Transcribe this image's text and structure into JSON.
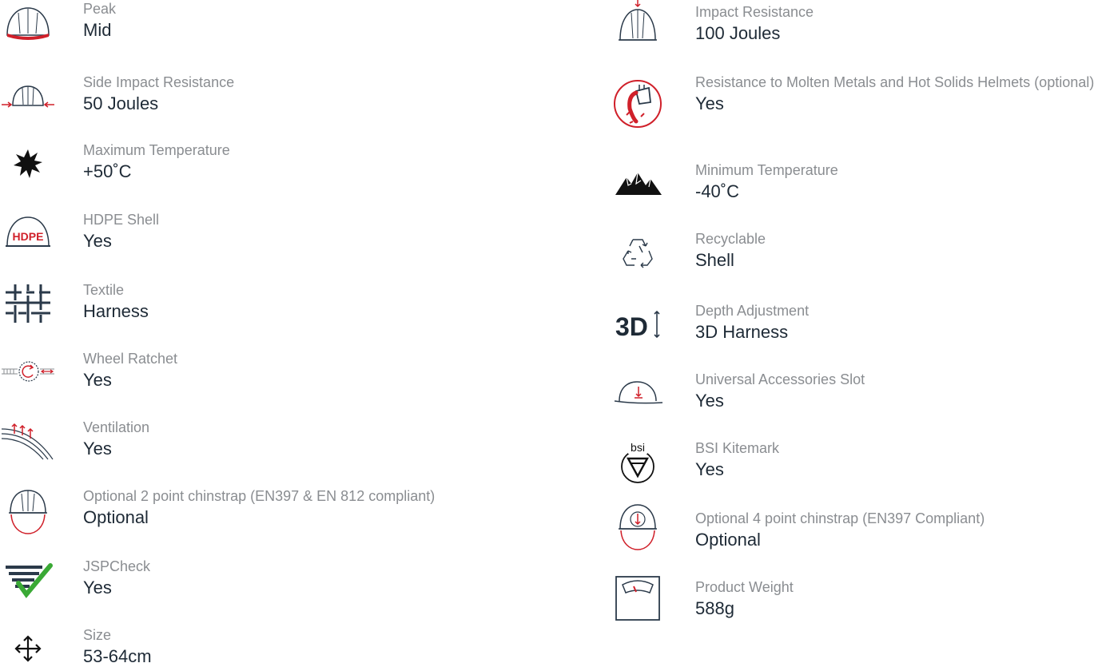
{
  "colors": {
    "label": "#8a8d91",
    "value": "#1e2a36",
    "accent_red": "#d0202a",
    "icon_dark": "#2b3a4a",
    "check_green": "#3aa935"
  },
  "left_specs": [
    {
      "icon": "helmet-peak-icon",
      "label": "Peak",
      "value": "Mid"
    },
    {
      "icon": "side-impact-icon",
      "label": "Side Impact Resistance",
      "value": "50 Joules"
    },
    {
      "icon": "sun-burst-icon",
      "label": "Maximum Temperature",
      "value": "+50˚C"
    },
    {
      "icon": "hdpe-helmet-icon",
      "label": "HDPE Shell",
      "value": "Yes",
      "icon_text": "HDPE"
    },
    {
      "icon": "textile-weave-icon",
      "label": "Textile",
      "value": "Harness"
    },
    {
      "icon": "wheel-ratchet-icon",
      "label": "Wheel Ratchet",
      "value": "Yes"
    },
    {
      "icon": "ventilation-icon",
      "label": "Ventilation",
      "value": "Yes"
    },
    {
      "icon": "chinstrap-2pt-icon",
      "label": "Optional 2 point chinstrap (EN397 & EN 812 compliant)",
      "value": "Optional"
    },
    {
      "icon": "jspcheck-icon",
      "label": "JSPCheck",
      "value": "Yes"
    },
    {
      "icon": "size-arrows-icon",
      "label": "Size",
      "value": "53-64cm"
    }
  ],
  "right_specs": [
    {
      "icon": "impact-resistance-icon",
      "label": "Impact Resistance",
      "value": "100 Joules"
    },
    {
      "icon": "molten-metal-icon",
      "label": "Resistance to Molten Metals and Hot Solids Helmets (optional)",
      "value": "Yes"
    },
    {
      "icon": "mountains-icon",
      "label": "Minimum Temperature",
      "value": "-40˚C"
    },
    {
      "icon": "recycle-icon",
      "label": "Recyclable",
      "value": "Shell"
    },
    {
      "icon": "depth-3d-icon",
      "label": "Depth Adjustment",
      "value": "3D Harness",
      "icon_text": "3D"
    },
    {
      "icon": "accessories-slot-icon",
      "label": "Universal Accessories Slot",
      "value": "Yes"
    },
    {
      "icon": "bsi-kitemark-icon",
      "label": "BSI Kitemark",
      "value": "Yes",
      "icon_text": "bsi"
    },
    {
      "icon": "chinstrap-4pt-icon",
      "label": "Optional 4 point chinstrap (EN397 Compliant)",
      "value": "Optional"
    },
    {
      "icon": "weight-scale-icon",
      "label": "Product Weight",
      "value": "588g"
    }
  ]
}
